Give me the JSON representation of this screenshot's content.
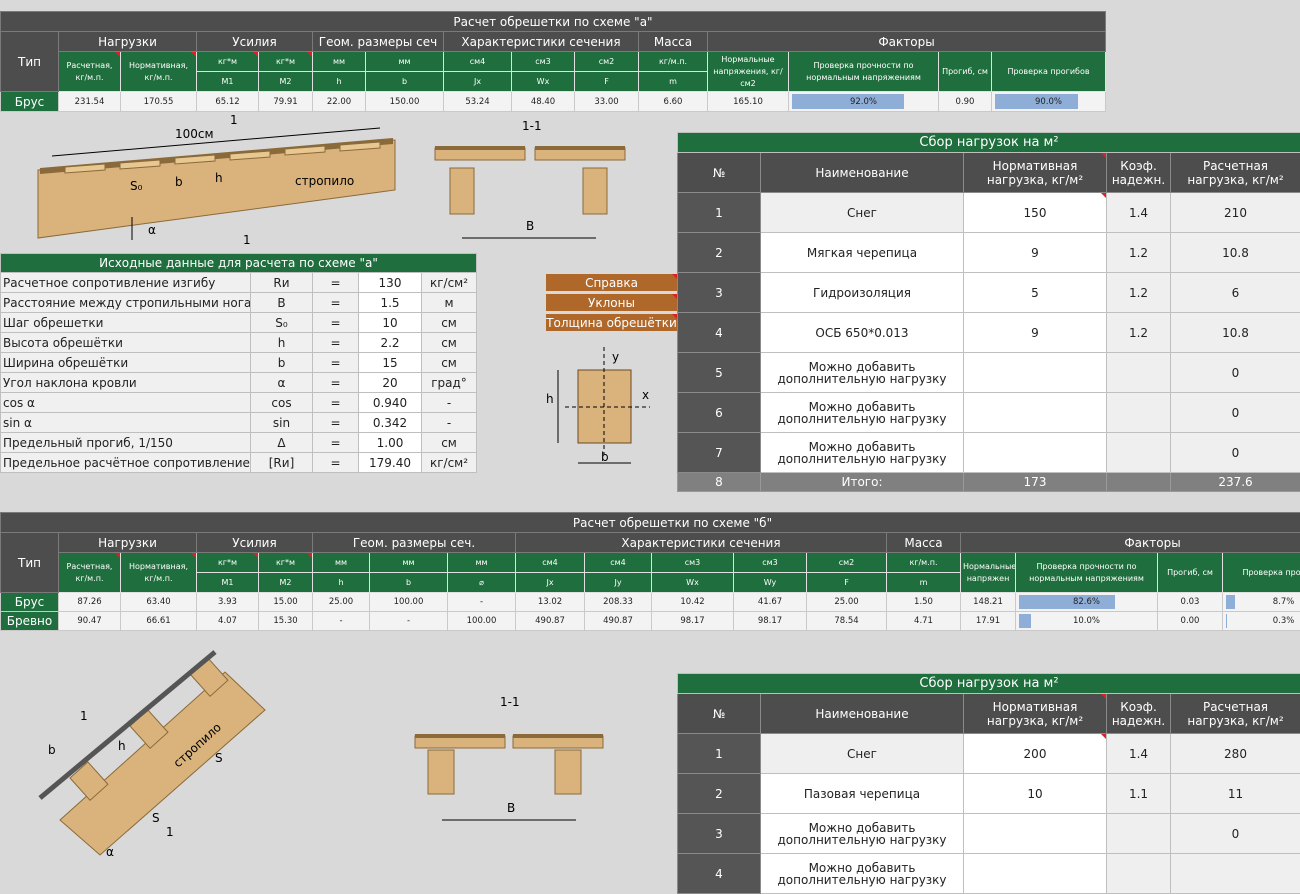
{
  "schemeA": {
    "title": "Расчет обрешетки по схеме \"а\"",
    "groups": [
      "Тип",
      "Нагрузки",
      "Усилия",
      "Геом. размеры сеч",
      "Характеристики сечения",
      "Масса",
      "Факторы"
    ],
    "units": [
      "Расчетная, кг/м.п.",
      "Нормативная, кг/м.п.",
      "кг*м",
      "кг*м",
      "мм",
      "мм",
      "см4",
      "см3",
      "см2",
      "кг/м.п.",
      "Нормальные напряжения, кг/см2",
      "Проверка прочности по нормальным напряжениям",
      "Прогиб, см",
      "Проверка прогибов"
    ],
    "syms": [
      "M1",
      "M2",
      "h",
      "b",
      "Jx",
      "Wx",
      "F",
      "m"
    ],
    "row": {
      "type": "Брус",
      "v": [
        "231.54",
        "170.55",
        "65.12",
        "79.91",
        "22.00",
        "150.00",
        "53.24",
        "48.40",
        "33.00",
        "6.60",
        "165.10"
      ],
      "check1": "92.0%",
      "check1_pct": 92,
      "deflection": "0.90",
      "check2": "90.0%",
      "check2_pct": 90
    }
  },
  "drawingA": {
    "len": "100см",
    "s0": "S₀",
    "b": "b",
    "h": "h",
    "rafter": "стропило",
    "one": "1",
    "alpha": "α",
    "sec": "1-1",
    "B": "B"
  },
  "initial": {
    "title": "Исходные данные для расчета по схеме \"а\"",
    "rows": [
      {
        "label": "Расчетное сопротивление изгибу",
        "sym": "Rи",
        "eq": "=",
        "val": "130",
        "unit": "кг/см²"
      },
      {
        "label": "Расстояние между стропильными ногами",
        "sym": "B",
        "eq": "=",
        "val": "1.5",
        "unit": "м"
      },
      {
        "label": "Шаг обрешетки",
        "sym": "S₀",
        "eq": "=",
        "val": "10",
        "unit": "см"
      },
      {
        "label": "Высота обрешётки",
        "sym": "h",
        "eq": "=",
        "val": "2.2",
        "unit": "см"
      },
      {
        "label": "Ширина обрешётки",
        "sym": "b",
        "eq": "=",
        "val": "15",
        "unit": "см"
      },
      {
        "label": "Угол наклона кровли",
        "sym": "α",
        "eq": "=",
        "val": "20",
        "unit": "град°"
      },
      {
        "label": "cos α",
        "sym": "cos",
        "eq": "=",
        "val": "0.940",
        "unit": "-"
      },
      {
        "label": "sin α",
        "sym": "sin",
        "eq": "=",
        "val": "0.342",
        "unit": "-"
      },
      {
        "label": "Предельный прогиб, 1/150",
        "sym": "Δ",
        "eq": "=",
        "val": "1.00",
        "unit": "см"
      },
      {
        "label": "Предельное расчётное сопротивление",
        "sym": "[Rи]",
        "eq": "=",
        "val": "179.40",
        "unit": "кг/см²"
      }
    ]
  },
  "buttons": [
    "Справка",
    "Уклоны",
    "Толщина обрешётки"
  ],
  "axes": {
    "y": "y",
    "x": "x",
    "h": "h",
    "b": "b"
  },
  "loadA": {
    "title": "Сбор нагрузок на м²",
    "headers": [
      "№",
      "Наименование",
      "Нормативная нагрузка, кг/м²",
      "Коэф. надежн.",
      "Расчетная нагрузка, кг/м²"
    ],
    "rows": [
      {
        "n": "1",
        "name": "Снег",
        "norm": "150",
        "k": "1.4",
        "calc": "210"
      },
      {
        "n": "2",
        "name": "Мягкая черепица",
        "norm": "9",
        "k": "1.2",
        "calc": "10.8"
      },
      {
        "n": "3",
        "name": "Гидроизоляция",
        "norm": "5",
        "k": "1.2",
        "calc": "6"
      },
      {
        "n": "4",
        "name": "ОСБ 650*0.013",
        "norm": "9",
        "k": "1.2",
        "calc": "10.8"
      },
      {
        "n": "5",
        "name": "Можно добавить дополнительную нагрузку",
        "norm": "",
        "k": "",
        "calc": "0"
      },
      {
        "n": "6",
        "name": "Можно добавить дополнительную нагрузку",
        "norm": "",
        "k": "",
        "calc": "0"
      },
      {
        "n": "7",
        "name": "Можно добавить дополнительную нагрузку",
        "norm": "",
        "k": "",
        "calc": "0"
      }
    ],
    "total": {
      "n": "8",
      "name": "Итого:",
      "norm": "173",
      "k": "",
      "calc": "237.6"
    }
  },
  "schemeB": {
    "title": "Расчет обрешетки по схеме \"б\"",
    "groups": [
      "Тип",
      "Нагрузки",
      "Усилия",
      "Геом. размеры сеч.",
      "Характеристики сечения",
      "Масса",
      "Факторы"
    ],
    "units": [
      "Расчетная, кг/м.п.",
      "Нормативная, кг/м.п.",
      "кг*м",
      "кг*м",
      "мм",
      "мм",
      "мм",
      "см4",
      "см4",
      "см3",
      "см3",
      "см2",
      "кг/м.п.",
      "Нормальные напряжен",
      "Проверка прочности по нормальным напряжениям",
      "Прогиб, см",
      "Проверка прогибов"
    ],
    "syms": [
      "M1",
      "M2",
      "h",
      "b",
      "⌀",
      "Jx",
      "Jy",
      "Wx",
      "Wy",
      "F",
      "m"
    ],
    "rows": [
      {
        "type": "Брус",
        "v": [
          "87.26",
          "63.40",
          "3.93",
          "15.00",
          "25.00",
          "100.00",
          "-",
          "13.02",
          "208.33",
          "10.42",
          "41.67",
          "25.00",
          "1.50",
          "148.21"
        ],
        "check1": "82.6%",
        "check1_pct": 82.6,
        "deflection": "0.03",
        "check2": "8.7%",
        "check2_pct": 8.7
      },
      {
        "type": "Бревно",
        "v": [
          "90.47",
          "66.61",
          "4.07",
          "15.30",
          "-",
          "-",
          "100.00",
          "490.87",
          "490.87",
          "98.17",
          "98.17",
          "78.54",
          "4.71",
          "17.91"
        ],
        "check1": "10.0%",
        "check1_pct": 10,
        "deflection": "0.00",
        "check2": "0.3%",
        "check2_pct": 0.3
      }
    ]
  },
  "drawingB": {
    "rafter": "стропило",
    "s": "S",
    "b": "b",
    "h": "h",
    "one": "1",
    "alpha": "α",
    "sec": "1-1",
    "B": "B"
  },
  "loadB": {
    "title": "Сбор нагрузок на м²",
    "headers": [
      "№",
      "Наименование",
      "Нормативная нагрузка, кг/м²",
      "Коэф. надежн.",
      "Расчетная нагрузка, кг/м²"
    ],
    "rows": [
      {
        "n": "1",
        "name": "Снег",
        "norm": "200",
        "k": "1.4",
        "calc": "280"
      },
      {
        "n": "2",
        "name": "Пазовая черепица",
        "norm": "10",
        "k": "1.1",
        "calc": "11"
      },
      {
        "n": "3",
        "name": "Можно добавить дополнительную нагрузку",
        "norm": "",
        "k": "",
        "calc": "0"
      },
      {
        "n": "4",
        "name": "Можно добавить дополнительную нагрузку",
        "norm": "",
        "k": "",
        "calc": ""
      }
    ]
  },
  "colors": {
    "green": "#1f6e3d",
    "darkgray": "#4d4d4d",
    "brown": "#b0682a",
    "bar": "#8eaed8",
    "wood": "#d9b27c"
  }
}
